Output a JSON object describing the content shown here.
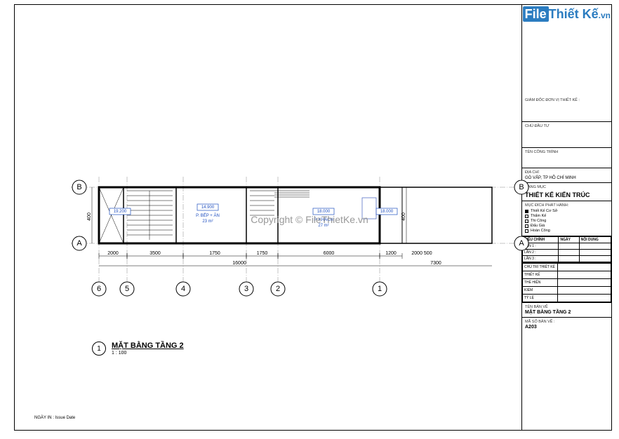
{
  "watermark": {
    "logo_file": "File",
    "logo_brand": "Thiết Kế",
    "logo_tld": ".vn",
    "center": "Copyright © FileThietKe.vn"
  },
  "title_block": {
    "designer_label": "GIÁM ĐỐC ĐƠN VỊ THIẾT KẾ :",
    "client_label": "CHỦ ĐẦU TƯ",
    "project_label": "TÊN CÔNG TRÌNH",
    "address_label": "ĐỊA CHỈ",
    "address_value": "GÒ VẤP, TP HỒ CHÍ MINH",
    "category_label": "HẠNG MỤC",
    "category_value": "THIẾT KẾ KIẾN TRÚC",
    "purpose_label": "MỤC ĐÍCH PHÁT HÀNH:",
    "purposes": [
      {
        "label": "Thiết Kế Cơ Sở",
        "checked": true
      },
      {
        "label": "Thẩm Kế",
        "checked": false
      },
      {
        "label": "Thi Công",
        "checked": false
      },
      {
        "label": "Đấu Giá",
        "checked": false
      },
      {
        "label": "Hoàn Công",
        "checked": false
      }
    ],
    "rev_headers": [
      "HIỆU CHỈNH",
      "NGÀY",
      "NỘI DUNG"
    ],
    "rev_rows": [
      "LẦN 1 :",
      "LẦN 2 :",
      "LẦN 3 :"
    ],
    "sig_rows": [
      "CHỦ TRÌ THIẾT KẾ",
      "THIẾT KẾ",
      "THỂ HIỆN",
      "KIỂM",
      "TỶ LỆ"
    ],
    "sheet_name_label": "TÊN BẢN VẼ",
    "sheet_name_value": "MẶT BẰNG TẦNG 2",
    "sheet_no_label": "MÃ SỐ BẢN VẼ :",
    "sheet_no_value": "A203"
  },
  "drawing": {
    "title_num": "1",
    "title_name": "MẶT BẰNG TẦNG 2",
    "title_scale": "1 : 100",
    "print_date": "NGÀY IN : Issue Date",
    "room1": "P. BẾP + ĂN",
    "room1_area": "23 m²",
    "room2": "P. KHÁCH",
    "room2_area": "27 m²",
    "level1": "14.900",
    "level2": "18.000",
    "level3": "18.000",
    "level4": "19.200",
    "h_dims": [
      "2000",
      "3500",
      "1750",
      "1750",
      "6000",
      "1200"
    ],
    "h_overall_left": "16000",
    "h_overall_right": "7300",
    "h_sub_right": "2000 500",
    "v_dim": "400",
    "grid_letters": [
      "A",
      "B"
    ],
    "grid_nums": [
      "1",
      "2",
      "3",
      "4",
      "5",
      "6"
    ]
  }
}
